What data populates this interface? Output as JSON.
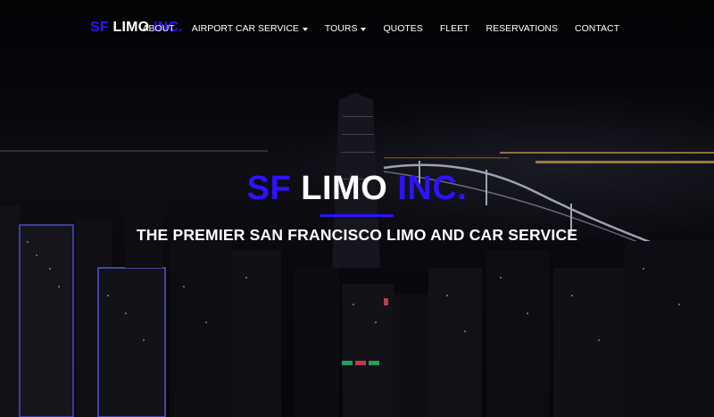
{
  "brand": {
    "part1": "SF",
    "part2": "LIMO",
    "part3": "INC.",
    "accent_color": "#2d13ff"
  },
  "nav": {
    "items": [
      {
        "label": "ABOUT",
        "has_dropdown": false
      },
      {
        "label": "AIRPORT CAR SERVICE",
        "has_dropdown": true
      },
      {
        "label": "TOURS",
        "has_dropdown": true
      },
      {
        "label": "QUOTES",
        "has_dropdown": false
      },
      {
        "label": "FLEET",
        "has_dropdown": false
      },
      {
        "label": "RESERVATIONS",
        "has_dropdown": false
      },
      {
        "label": "CONTACT",
        "has_dropdown": false
      }
    ]
  },
  "hero": {
    "title": {
      "part1": "SF",
      "part2": "LIMO",
      "part3": "INC."
    },
    "tagline": "THE PREMIER SAN FRANCISCO LIMO AND CAR SERVICE"
  }
}
